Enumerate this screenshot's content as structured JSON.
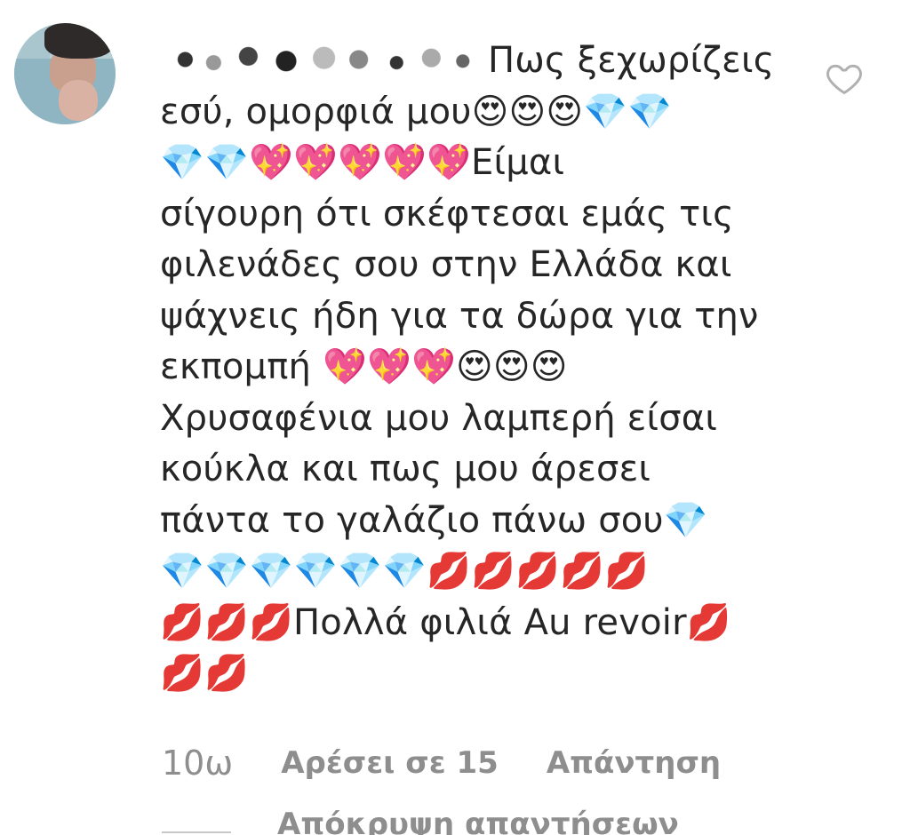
{
  "comment": {
    "username_redacted": true,
    "text_lines": [
      "Πως ξεχωρίζεις",
      "εσύ, ομορφιά μου😍😍😍💎💎",
      "💎💎💖💖💖💖💖Είμαι",
      "σίγουρη ότι σκέφτεσαι εμάς τις",
      "φιλενάδες σου στην Ελλάδα και",
      "ψάχνεις ήδη για τα δώρα για την",
      "εκπομπή 💖💖💖😍😍😍",
      "Χρυσαφένια μου λαμπερή είσαι",
      "κούκλα και πως μου άρεσει",
      "πάντα το γαλάζιο πάνω σου💎",
      "💎💎💎💎💎💎💋💋💋💋💋",
      "💋💋💋Πολλά φιλιά Au revoir💋",
      "💋💋"
    ]
  },
  "footer": {
    "timestamp": "10ω",
    "likes": "Αρέσει σε 15",
    "reply": "Απάντηση"
  },
  "replies": {
    "hide_label": "Απόκρυψη απαντήσεων"
  },
  "icons": {
    "like": "heart-outline-icon",
    "avatar": "user-avatar"
  },
  "colors": {
    "text": "#262626",
    "secondary": "#8e8e8e"
  }
}
